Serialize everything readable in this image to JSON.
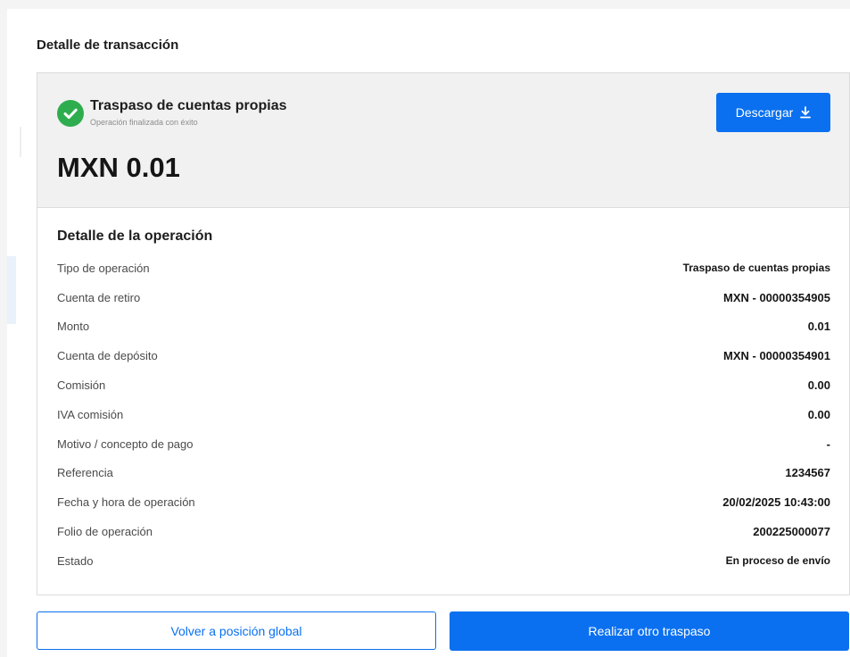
{
  "page_title": "Detalle de transacción",
  "summary": {
    "title": "Traspaso de cuentas propias",
    "subtitle": "Operación finalizada con éxito",
    "status_icon": "check-circle-icon",
    "status_color": "#2ead4e",
    "amount": "MXN 0.01",
    "download_label": "Descargar",
    "download_icon": "download-icon"
  },
  "details": {
    "title": "Detalle de la operación",
    "rows": [
      {
        "label": "Tipo de operación",
        "value": "Traspaso de cuentas propias"
      },
      {
        "label": "Cuenta de retiro",
        "value": "MXN - 00000354905"
      },
      {
        "label": "Monto",
        "value": "0.01"
      },
      {
        "label": "Cuenta de depósito",
        "value": "MXN - 00000354901"
      },
      {
        "label": "Comisión",
        "value": "0.00"
      },
      {
        "label": "IVA comisión",
        "value": "0.00"
      },
      {
        "label": "Motivo / concepto de pago",
        "value": "-"
      },
      {
        "label": "Referencia",
        "value": "1234567"
      },
      {
        "label": "Fecha y hora de operación",
        "value": "20/02/2025 10:43:00"
      },
      {
        "label": "Folio de operación",
        "value": "200225000077"
      },
      {
        "label": "Estado",
        "value": "En proceso de envío"
      }
    ]
  },
  "actions": {
    "back_label": "Volver a posición global",
    "new_transfer_label": "Realizar otro traspaso"
  },
  "colors": {
    "accent": "#0a70f0",
    "success": "#2ead4e"
  }
}
